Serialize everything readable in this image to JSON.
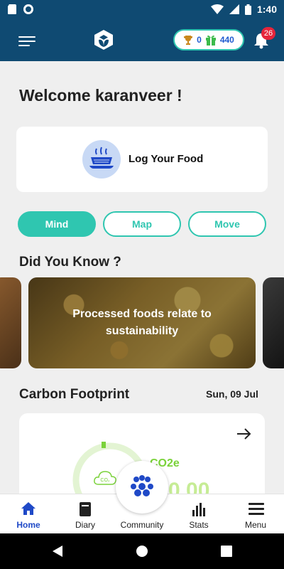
{
  "status_bar": {
    "time": "1:40"
  },
  "header": {
    "trophy_count": "0",
    "gift_count": "440",
    "notification_count": "26"
  },
  "welcome": {
    "text": "Welcome karanveer !"
  },
  "log_food": {
    "label": "Log Your Food"
  },
  "tabs": [
    {
      "label": "Mind",
      "active": true
    },
    {
      "label": "Map",
      "active": false
    },
    {
      "label": "Move",
      "active": false
    }
  ],
  "did_you_know": {
    "title": "Did You Know ?",
    "card_text": "Processed foods relate to sustainability"
  },
  "carbon": {
    "title": "Carbon Footprint",
    "date": "Sun, 09 Jul",
    "unit_label": "CO2e",
    "cloud_label": "CO₂",
    "value": "0.00",
    "progress": 0
  },
  "bottom_nav": [
    {
      "label": "Home",
      "icon": "home-icon",
      "active": true
    },
    {
      "label": "Diary",
      "icon": "diary-icon",
      "active": false
    },
    {
      "label": "Community",
      "icon": "community-icon",
      "active": false
    },
    {
      "label": "Stats",
      "icon": "stats-icon",
      "active": false
    },
    {
      "label": "Menu",
      "icon": "menu-icon",
      "active": false
    }
  ],
  "colors": {
    "header": "#0f4a72",
    "accent": "#2fc6b0",
    "nav_active": "#1f49c7",
    "badge": "#e6253b"
  }
}
